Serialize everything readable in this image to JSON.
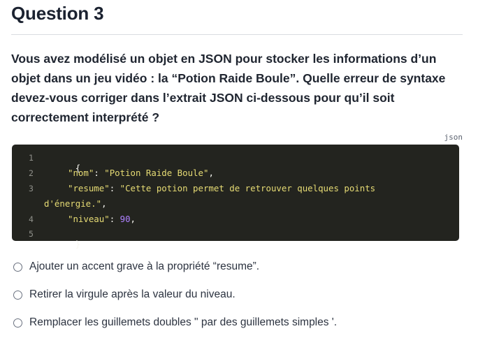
{
  "header": {
    "title": "Question 3"
  },
  "question": {
    "text": "Vous avez modélisé un objet en JSON pour stocker les informations d’un objet dans un jeu vidéo : la “Potion Raide Boule”. Quelle erreur de syntaxe devez-vous corriger dans l’extrait JSON ci-dessous pour qu’il soit correctement interprété ?"
  },
  "code_block": {
    "language": "json",
    "line_numbers": [
      "1",
      "2",
      "3",
      "4",
      "5"
    ],
    "open_brace": "{",
    "close_brace": "}",
    "key_nom": "\"nom\"",
    "val_nom": "\"Potion Raide Boule\"",
    "key_resume": "\"resume\"",
    "val_resume_part1": "\"Cette potion permet de retrouver quelques points",
    "val_resume_part2": "d'énergie.\"",
    "key_niveau": "\"niveau\"",
    "val_niveau": "90",
    "colon": ": ",
    "comma": ","
  },
  "options": [
    {
      "label": "Ajouter un accent grave à la propriété “resume”."
    },
    {
      "label": "Retirer la virgule après la valeur du niveau."
    },
    {
      "label": "Remplacer les guillemets doubles \" par des guillemets simples '."
    }
  ]
}
